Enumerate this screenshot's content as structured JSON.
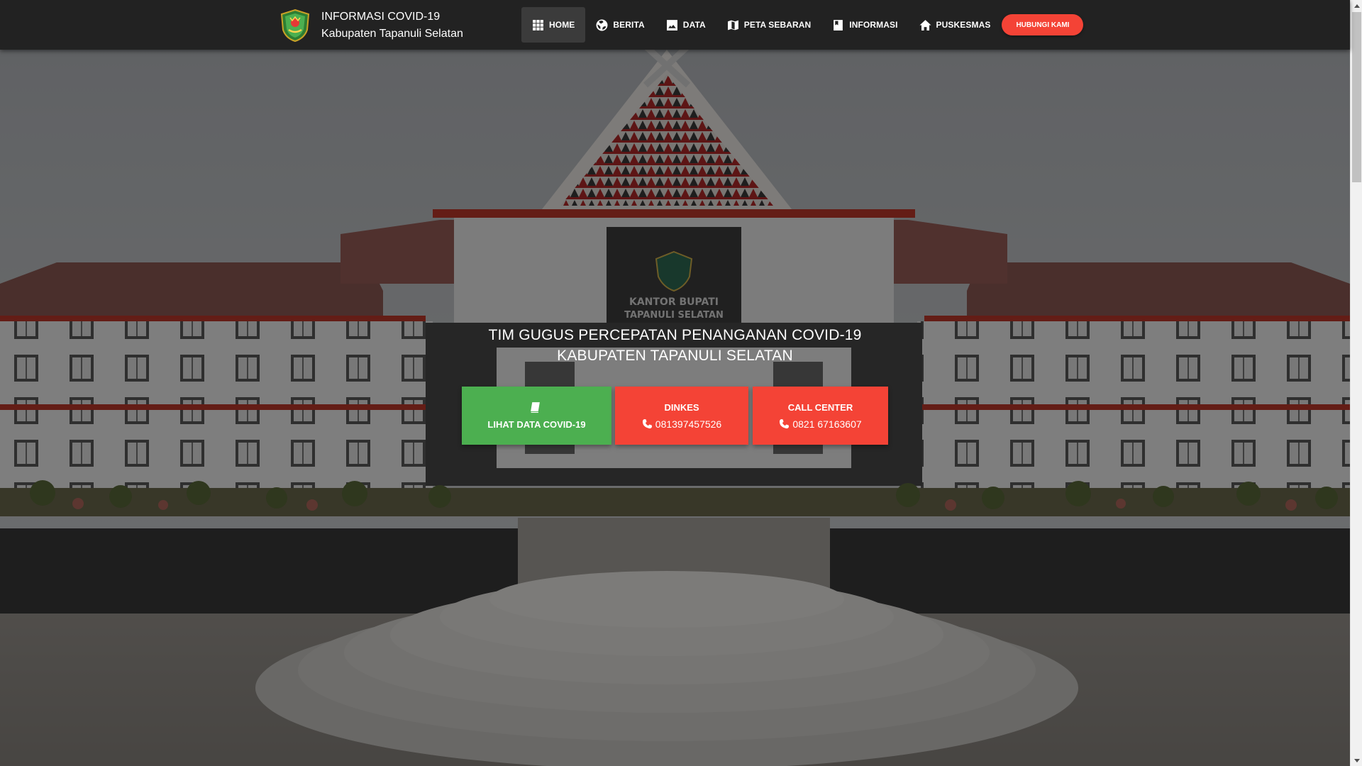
{
  "brand": {
    "line1": "INFORMASI COVID-19",
    "line2": "Kabupaten Tapanuli Selatan",
    "logo_icon": "regency-shield-emblem-icon"
  },
  "nav": {
    "items": [
      {
        "label": "HOME",
        "icon": "grid-icon",
        "active": true
      },
      {
        "label": "BERITA",
        "icon": "globe-icon"
      },
      {
        "label": "DATA",
        "icon": "image-icon"
      },
      {
        "label": "PETA SEBARAN",
        "icon": "map-icon"
      },
      {
        "label": "INFORMASI",
        "icon": "book-icon"
      },
      {
        "label": "PUSKESMAS",
        "icon": "home-icon"
      }
    ],
    "contact_label": "HUBUNGI KAMI"
  },
  "hero": {
    "title_line1": "TIM GUGUS PERCEPATAN PENANGANAN COVID-19",
    "title_line2": "KABUPATEN TAPANULI SELATAN",
    "background": "kantor-bupati-building-photo",
    "sign_line1": "KANTOR BUPATI",
    "sign_line2": "TAPANULI SELATAN",
    "buttons": {
      "data_label": "LIHAT DATA COVID-19",
      "dinkes_label": "DINKES",
      "dinkes_phone": "081397457526",
      "callcenter_label": "CALL CENTER",
      "callcenter_phone": "0821 67163607"
    }
  },
  "colors": {
    "navbar": "#222222",
    "accent_red": "#f44336",
    "accent_green": "#4caf50"
  }
}
